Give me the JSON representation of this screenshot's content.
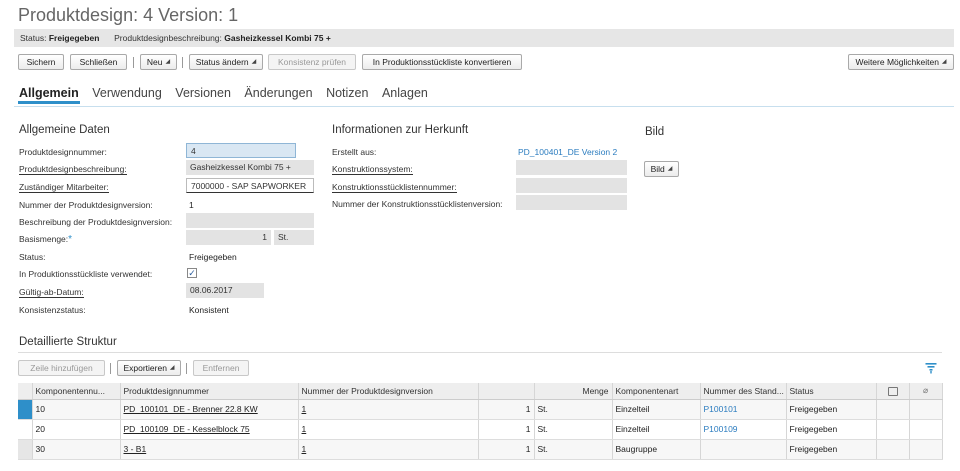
{
  "page": {
    "title": "Produktdesign: 4 Version: 1",
    "status_label": "Status:",
    "status_value": "Freigegeben",
    "desc_label": "Produktdesignbeschreibung:",
    "desc_value": "Gasheizkessel Kombi 75 +"
  },
  "toolbar": {
    "save": "Sichern",
    "close": "Schließen",
    "new": "Neu",
    "change_status": "Status ändern",
    "check_consistency": "Konsistenz prüfen",
    "convert": "In Produktionsstückliste konvertieren",
    "more": "Weitere Möglichkeiten"
  },
  "tabs": [
    "Allgemein",
    "Verwendung",
    "Versionen",
    "Änderungen",
    "Notizen",
    "Anlagen"
  ],
  "general": {
    "heading": "Allgemeine Daten",
    "fields": {
      "number_label": "Produktdesignnummer:",
      "number_value": "4",
      "desc_label": "Produktdesignbeschreibung:",
      "desc_value": "Gasheizkessel Kombi 75 +",
      "employee_label": "Zuständiger Mitarbeiter:",
      "employee_value": "7000000 - SAP SAPWORKER",
      "version_label": "Nummer der Produktdesignversion:",
      "version_value": "1",
      "version_desc_label": "Beschreibung der Produktdesignversion:",
      "version_desc_value": "",
      "base_qty_label": "Basismenge:",
      "base_qty_required": "*",
      "base_qty_value": "1",
      "base_qty_unit": "St.",
      "status_label": "Status:",
      "status_value": "Freigegeben",
      "used_in_bom_label": "In Produktionsstückliste verwendet:",
      "used_in_bom_checked": "✓",
      "valid_from_label": "Gültig-ab-Datum:",
      "valid_from_value": "08.06.2017",
      "consistency_label": "Konsistenzstatus:",
      "consistency_value": "Konsistent"
    }
  },
  "origin": {
    "heading": "Informationen zur Herkunft",
    "created_from_label": "Erstellt aus:",
    "created_from_value": "PD_100401_DE Version 2",
    "design_system_label": "Konstruktionssystem:",
    "design_bom_label": "Konstruktionsstücklistennummer:",
    "design_bom_version_label": "Nummer der Konstruktionsstücklistenversion:"
  },
  "image": {
    "heading": "Bild",
    "button": "Bild"
  },
  "structure": {
    "heading": "Detaillierte Struktur",
    "add_line": "Zeile hinzufügen",
    "export": "Exportieren",
    "remove": "Entfernen",
    "columns": [
      "Komponentennu...",
      "Produktdesignnummer",
      "Nummer der Produktdesignversion",
      "",
      "Menge",
      "Komponentenart",
      "Nummer des Stand...",
      "Status",
      "",
      ""
    ],
    "rows": [
      {
        "comp": "10",
        "design": "PD_100101_DE - Brenner 22.8 KW",
        "version": "1",
        "qty": "1",
        "unit": "St.",
        "type": "Einzelteil",
        "std": "P100101",
        "status": "Freigegeben"
      },
      {
        "comp": "20",
        "design": "PD_100109_DE - Kesselblock 75",
        "version": "1",
        "qty": "1",
        "unit": "St.",
        "type": "Einzelteil",
        "std": "P100109",
        "status": "Freigegeben"
      },
      {
        "comp": "30",
        "design": "3 - B1",
        "version": "1",
        "qty": "1",
        "unit": "St.",
        "type": "Baugruppe",
        "std": "",
        "status": "Freigegeben"
      }
    ]
  },
  "colors": {
    "accent": "#2e8fc9",
    "link": "#2b7cbf",
    "field_bg": "#e3e3e3"
  }
}
